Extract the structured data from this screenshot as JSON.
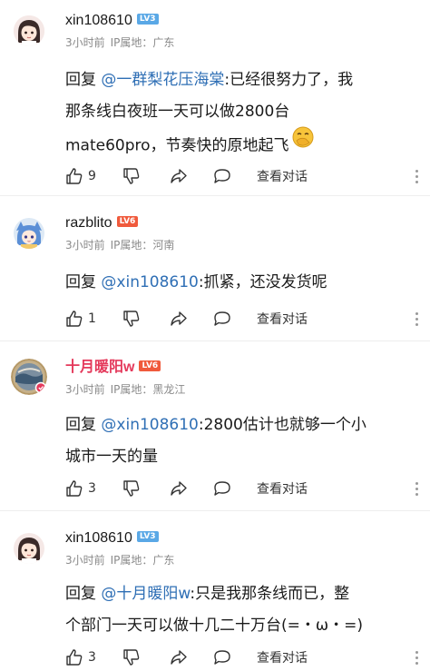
{
  "colors": {
    "mention": "#2f6fb5",
    "meta": "#8a8a8a",
    "badge_lv3": "#5aa8e6",
    "badge_lv6": "#f05a3c",
    "vip_name": "#e4395b"
  },
  "comments": [
    {
      "username": "xin108610",
      "level": "LV3",
      "time": "3小时前",
      "ip_label": "IP属地：",
      "ip_location": "广东",
      "reply_word": "回复",
      "mention": "@一群梨花压海棠",
      "text_line1_rest": ":已经很努力了，我",
      "text_line2": "那条线白夜班一天可以做2800台",
      "text_line3": "mate60pro，节奏快的原地起飞",
      "emoji": "face-with-hand-over-mouth",
      "likes": "9",
      "view_dialog": "查看对话"
    },
    {
      "username": "razblito",
      "level": "LV6",
      "time": "3小时前",
      "ip_label": "IP属地：",
      "ip_location": "河南",
      "reply_word": "回复",
      "mention": "@xin108610",
      "text_line1_rest": ":抓紧，还没发货呢",
      "likes": "1",
      "view_dialog": "查看对话"
    },
    {
      "username": "十月暖阳w",
      "level": "LV6",
      "time": "3小时前",
      "ip_label": "IP属地：",
      "ip_location": "黑龙江",
      "reply_word": "回复",
      "mention": "@xin108610",
      "text_line1_rest": ":2800估计也就够一个小",
      "text_line2": "城市一天的量",
      "likes": "3",
      "view_dialog": "查看对话"
    },
    {
      "username": "xin108610",
      "level": "LV3",
      "time": "3小时前",
      "ip_label": "IP属地：",
      "ip_location": "广东",
      "reply_word": "回复",
      "mention": "@十月暖阳w",
      "text_line1_rest": ":只是我那条线而已，整",
      "text_line2": "个部门一天可以做十几二十万台(=・ω・=)",
      "likes": "3",
      "view_dialog": "查看对话"
    }
  ]
}
